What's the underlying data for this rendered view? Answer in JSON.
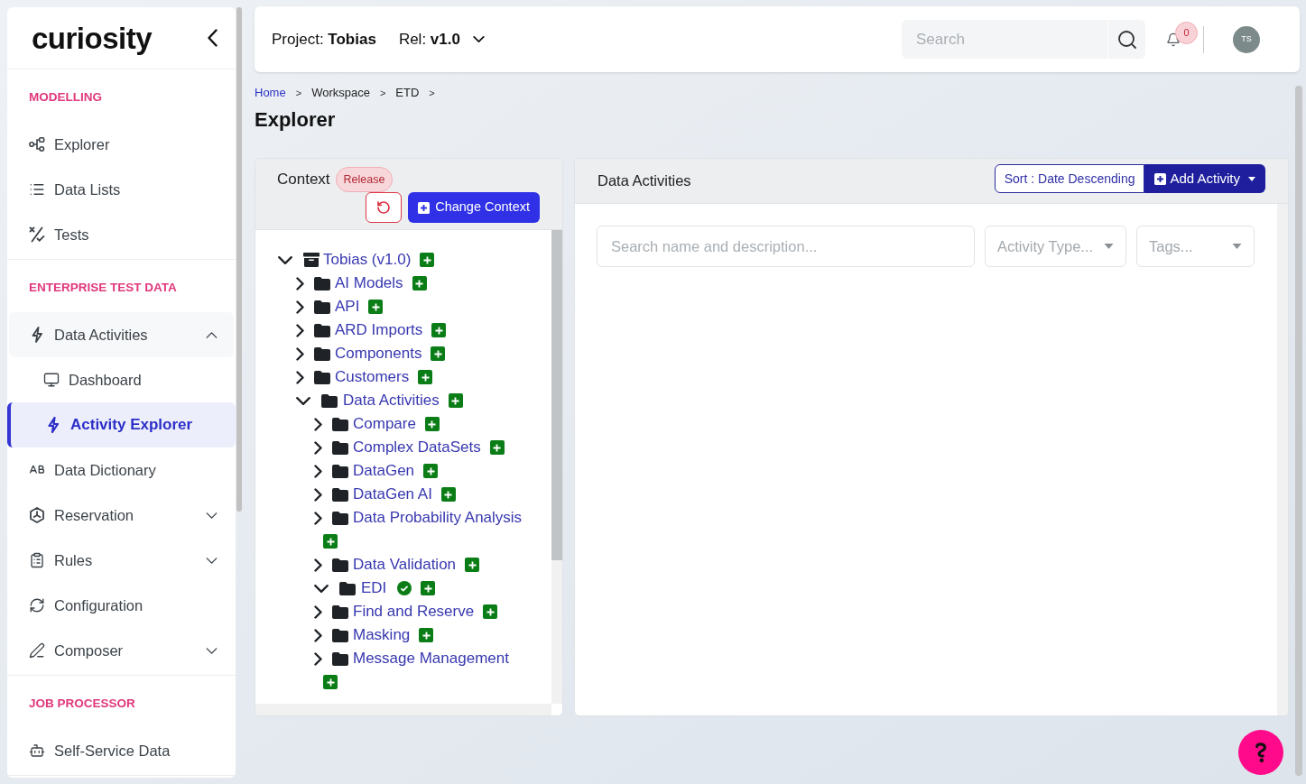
{
  "sidebar": {
    "logo": "curiosity",
    "sections": [
      {
        "title": "MODELLING",
        "items": [
          {
            "label": "Explorer",
            "selected": false
          },
          {
            "label": "Data Lists",
            "selected": false
          },
          {
            "label": "Tests",
            "selected": false
          }
        ]
      },
      {
        "title": "ENTERPRISE TEST DATA",
        "items": [
          {
            "label": "Data Activities",
            "selected": false,
            "expanded": true,
            "children": [
              {
                "label": "Dashboard",
                "selected": false
              },
              {
                "label": "Activity Explorer",
                "selected": true
              }
            ]
          },
          {
            "label": "Data Dictionary",
            "selected": false
          },
          {
            "label": "Reservation",
            "selected": false,
            "expanded": false
          },
          {
            "label": "Rules",
            "selected": false,
            "expanded": false
          },
          {
            "label": "Configuration",
            "selected": false
          },
          {
            "label": "Composer",
            "selected": false,
            "expanded": false
          }
        ]
      },
      {
        "title": "JOB PROCESSOR",
        "items": [
          {
            "label": "Self-Service Data",
            "selected": false
          }
        ]
      }
    ]
  },
  "header": {
    "project": "Project: **Tobias**",
    "release": "Rel: **v1.0**",
    "search": {
      "placeholder": "Search"
    },
    "notification_count": "0",
    "avatar": "TS"
  },
  "breadcrumb": [
    {
      "label": "Home",
      "link": true,
      "separator": ">"
    },
    {
      "label": "Workspace",
      "link": false,
      "separator": ">"
    },
    {
      "label": "ETD",
      "link": false,
      "separator": ">"
    }
  ],
  "page_title": "Explorer",
  "context_panel": {
    "title": "Context",
    "badge": "Release",
    "change_button": "Change Context",
    "tree": [
      {
        "label": "Tobias (v1.0)",
        "kind": "project",
        "expanded": true,
        "checked": false,
        "children": [
          {
            "label": "AI Models",
            "kind": "folder",
            "expanded": false,
            "checked": false
          },
          {
            "label": "API",
            "kind": "folder",
            "expanded": false,
            "checked": false
          },
          {
            "label": "ARD Imports",
            "kind": "folder",
            "expanded": false,
            "checked": false
          },
          {
            "label": "Components",
            "kind": "folder",
            "expanded": false,
            "checked": false
          },
          {
            "label": "Customers",
            "kind": "folder",
            "expanded": false,
            "checked": false
          },
          {
            "label": "Data Activities",
            "kind": "folder",
            "expanded": true,
            "checked": false,
            "children": [
              {
                "label": "Compare",
                "kind": "folder",
                "expanded": false,
                "checked": false
              },
              {
                "label": "Complex DataSets",
                "kind": "folder",
                "expanded": false,
                "checked": false
              },
              {
                "label": "DataGen",
                "kind": "folder",
                "expanded": false,
                "checked": false
              },
              {
                "label": "DataGen AI",
                "kind": "folder",
                "expanded": false,
                "checked": false
              },
              {
                "label": "Data Probability Analysis",
                "kind": "folder",
                "expanded": false,
                "checked": false
              },
              {
                "label": "Data Validation",
                "kind": "folder",
                "expanded": false,
                "checked": false
              },
              {
                "label": "EDI",
                "kind": "folder",
                "expanded": true,
                "checked": true
              },
              {
                "label": "Find and Reserve",
                "kind": "folder",
                "expanded": false,
                "checked": false
              },
              {
                "label": "Masking",
                "kind": "folder",
                "expanded": false,
                "checked": false
              },
              {
                "label": "Message Management",
                "kind": "folder",
                "expanded": false,
                "checked": false
              }
            ]
          }
        ]
      }
    ]
  },
  "activities_panel": {
    "title": "Data Activities",
    "sort_button": "Sort : Date Descending",
    "add_button": "Add Activity",
    "search": {
      "placeholder": "Search name and description..."
    },
    "filters": [
      {
        "placeholder": "Activity Type..."
      },
      {
        "placeholder": "Tags..."
      }
    ]
  }
}
